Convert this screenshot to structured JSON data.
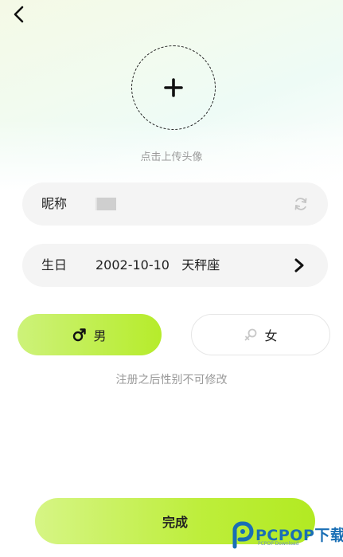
{
  "colors": {
    "accent": "#b6ec2b",
    "row_bg": "#f4f4f4",
    "text": "#222222",
    "hint": "#999999"
  },
  "header": {
    "back_icon": "chevron-left-icon"
  },
  "avatar": {
    "icon": "plus-icon",
    "hint": "点击上传头像"
  },
  "nickname": {
    "label": "昵称",
    "refresh_icon": "refresh-icon"
  },
  "birthday": {
    "label": "生日",
    "date": "2002-10-10",
    "zodiac": "天秤座",
    "arrow_icon": "chevron-right-icon"
  },
  "gender": {
    "male": {
      "label": "男",
      "icon": "male-icon",
      "selected": true
    },
    "female": {
      "label": "女",
      "icon": "female-icon",
      "selected": false
    }
  },
  "note": "注册之后性别不可修改",
  "done_label": "完成",
  "watermark": {
    "brand": "PCPOP下载",
    "sub": "PCPOP Download"
  }
}
